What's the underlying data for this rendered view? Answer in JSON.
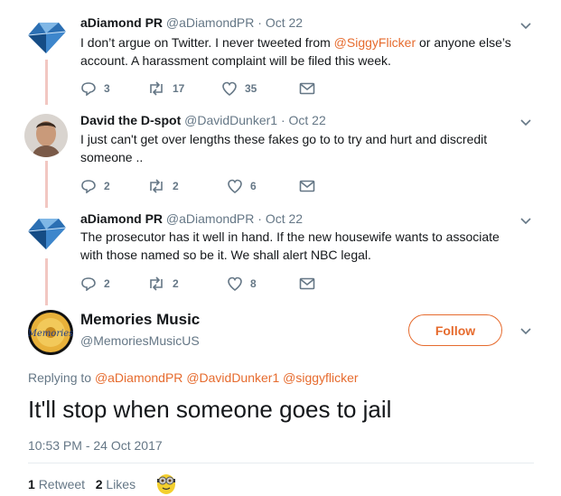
{
  "tweets": [
    {
      "name": "aDiamond PR",
      "handle": "@aDiamondPR",
      "date": "Oct 22",
      "text_before": "I don’t argue on Twitter. I never tweeted from ",
      "mention": "@SiggyFlicker",
      "text_after": " or anyone else’s account. A harassment complaint will be filed this week.",
      "replies": "3",
      "retweets": "17",
      "likes": "35"
    },
    {
      "name": "David the D-spot",
      "handle": "@DavidDunker1",
      "date": "Oct 22",
      "text": "I just can't get over lengths these fakes go to to try and hurt and discredit someone ..",
      "replies": "2",
      "retweets": "2",
      "likes": "6"
    },
    {
      "name": "aDiamond PR",
      "handle": "@aDiamondPR",
      "date": "Oct 22",
      "text": "The prosecutor has it well in hand. If the new housewife wants to associate with those named so be it. We shall alert NBC legal.",
      "replies": "2",
      "retweets": "2",
      "likes": "8"
    }
  ],
  "dot": "·",
  "main": {
    "name": "Memories Music",
    "handle": "@MemoriesMusicUS",
    "follow_label": "Follow",
    "replying_prefix": "Replying to",
    "replying_to": [
      "@aDiamondPR",
      "@DavidDunker1",
      "@siggyflicker"
    ],
    "text": "It'll stop when someone goes to jail",
    "timestamp": "10:53 PM - 24 Oct 2017",
    "retweet_count": "1",
    "retweet_label": "Retweet",
    "like_count": "2",
    "like_label": "Likes",
    "avatar_text": "Memories"
  },
  "colors": {
    "accent": "#e66b2e",
    "muted": "#657786",
    "thread_line": "#f2c7c2"
  }
}
